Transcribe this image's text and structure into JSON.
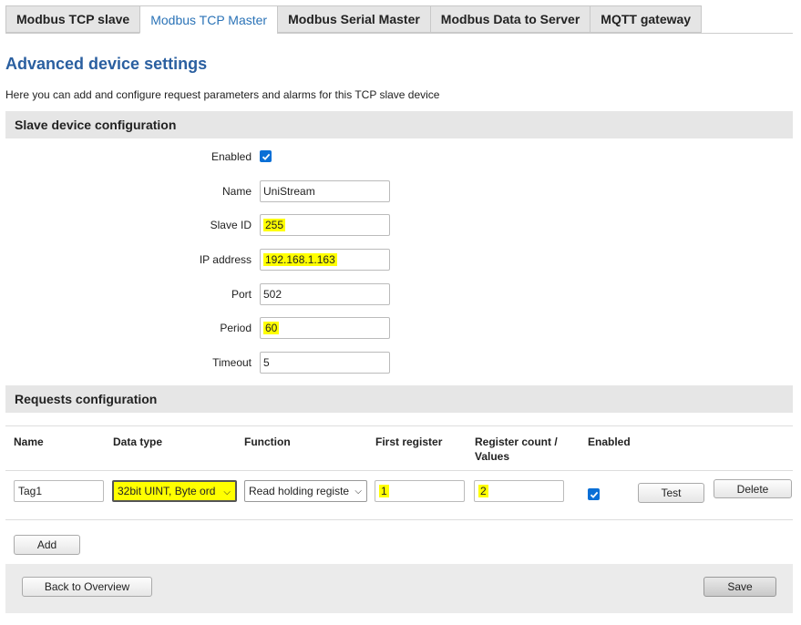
{
  "tabs": [
    {
      "label": "Modbus TCP slave",
      "active": false
    },
    {
      "label": "Modbus TCP Master",
      "active": true
    },
    {
      "label": "Modbus Serial Master",
      "active": false
    },
    {
      "label": "Modbus Data to Server",
      "active": false
    },
    {
      "label": "MQTT gateway",
      "active": false
    }
  ],
  "page": {
    "title": "Advanced device settings",
    "intro": "Here you can add and configure request parameters and alarms for this TCP slave device"
  },
  "slave": {
    "header": "Slave device configuration",
    "enabled_label": "Enabled",
    "enabled": true,
    "name_label": "Name",
    "name_value": "UniStream",
    "slave_id_label": "Slave ID",
    "slave_id_value": "255",
    "ip_label": "IP address",
    "ip_value": "192.168.1.163",
    "port_label": "Port",
    "port_value": "502",
    "period_label": "Period",
    "period_value": "60",
    "timeout_label": "Timeout",
    "timeout_value": "5"
  },
  "requests": {
    "header": "Requests configuration",
    "columns": {
      "name": "Name",
      "data_type": "Data type",
      "function": "Function",
      "first_register": "First register",
      "register_count_line1": "Register count /",
      "register_count_line2": "Values",
      "enabled": "Enabled"
    },
    "rows": [
      {
        "name": "Tag1",
        "data_type": "32bit UINT, Byte ord",
        "function": "Read holding registe",
        "first_register": "1",
        "register_count": "2",
        "enabled": true,
        "test_label": "Test",
        "delete_label": "Delete"
      }
    ],
    "add_label": "Add"
  },
  "footer": {
    "back_label": "Back to Overview",
    "save_label": "Save"
  },
  "colors": {
    "accent": "#2a5fa0",
    "highlight": "#ffff00",
    "checkbox": "#0a6fd6"
  }
}
